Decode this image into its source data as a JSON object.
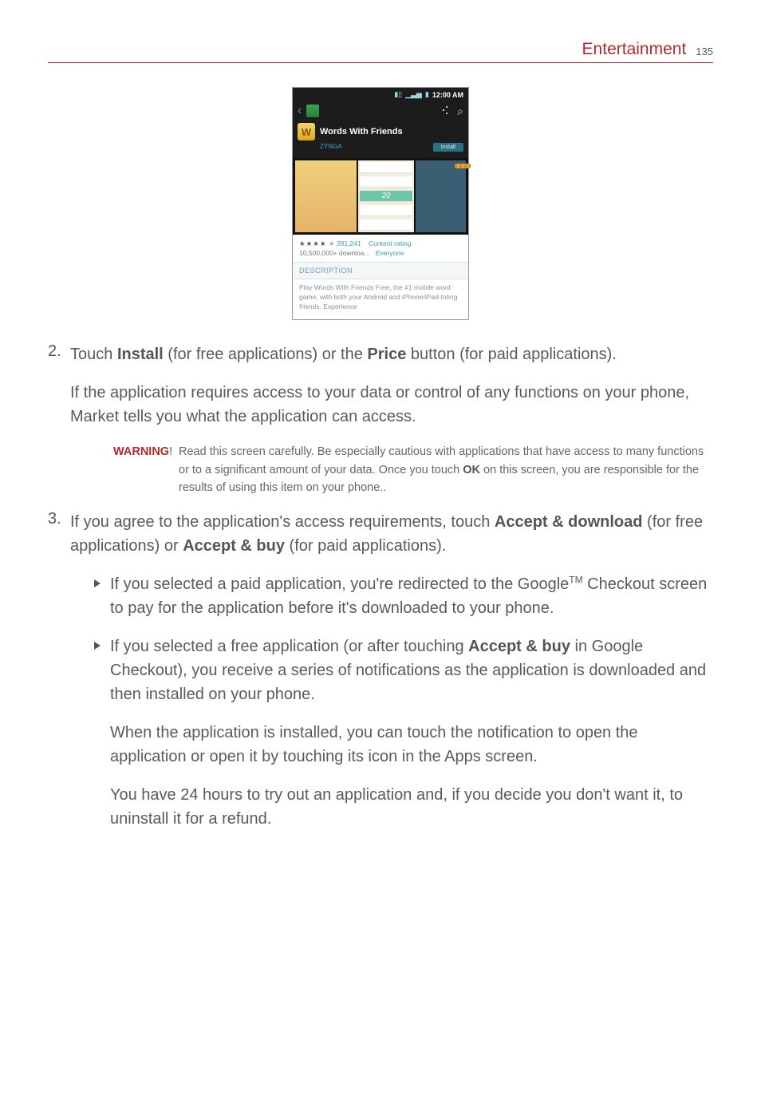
{
  "header": {
    "section": "Entertainment",
    "page_number": "135"
  },
  "screenshot": {
    "status_time": "12:00 AM",
    "share_icon_name": "share-icon",
    "search_icon_name": "search-icon",
    "back_icon_name": "back-icon",
    "market_icon_name": "bag-icon",
    "app_icon_letter": "W",
    "app_title": "Words With Friends",
    "publisher": "ZYNGA",
    "install_label": "Install",
    "shot2_number": "20",
    "stars": "★★★★",
    "review_count": "281,241",
    "content_rating": "Content rating",
    "downloads": "10,500,000+ downloa...",
    "downloads_audience": "Everyone",
    "description_heading": "DESCRIPTION",
    "description_body": "Play Words With Friends Free, the #1 mobile word game, with both your Android and iPhone/iPad-toting friends. Experience"
  },
  "step2": {
    "pre": "Touch ",
    "bold1": "Install",
    "mid": " (for free applications) or the ",
    "bold2": "Price",
    "post": " button (for paid applications).",
    "para2": "If the application requires access to your data or control of any functions on your phone, Market tells you what the application can access."
  },
  "warning": {
    "label": "WARNING",
    "excl": "!",
    "body_pre": "Read this screen carefully. Be especially cautious with applications that have access to many functions or to a significant amount of your data. Once you touch ",
    "body_bold": "OK",
    "body_post": " on this screen, you are responsible for the results of using this item on your phone."
  },
  "step3": {
    "pre": "If you agree to the application's access requirements, touch ",
    "bold1": "Accept & download",
    "mid": " (for free applications) or ",
    "bold2": "Accept & buy",
    "post": " (for paid applications).",
    "bullet1_pre": "If you selected a paid application, you're redirected to the Google",
    "bullet1_tm": "TM",
    "bullet1_post": " Checkout screen to pay for the application before it's downloaded to your phone.",
    "bullet2_pre": "If you selected a free application (or after touching ",
    "bullet2_bold": "Accept & buy",
    "bullet2_post": " in Google Checkout), you receive a series of notifications as the application is downloaded and then installed on your phone.",
    "follow1": "When the application is installed, you can touch the notification to open the application or open it by touching its icon in the Apps screen.",
    "follow2": "You have 24 hours to try out an application and, if you decide you don't want it, to uninstall it for a refund."
  }
}
